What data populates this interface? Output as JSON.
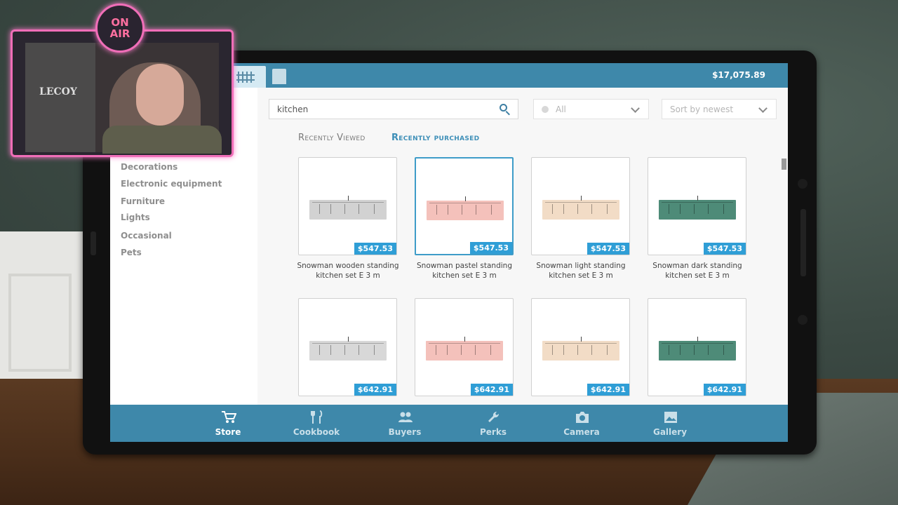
{
  "balance": "$17,075.89",
  "search": {
    "value": "kitchen"
  },
  "filter": {
    "selected": "All"
  },
  "sort": {
    "selected": "Sort by newest"
  },
  "tabs": {
    "recently_viewed": "Recently Viewed",
    "recently_purchased": "Recently purchased"
  },
  "categories": [
    "Decorations",
    "Electronic equipment",
    "Furniture",
    "Lights",
    "Occasional",
    "Pets"
  ],
  "products": [
    {
      "name1": "Snowman wooden standing",
      "name2": "kitchen set E 3 m",
      "price": "$547.53",
      "color": "#d2d2d2"
    },
    {
      "name1": "Snowman pastel standing",
      "name2": "kitchen set E 3 m",
      "price": "$547.53",
      "color": "#f4c1bb"
    },
    {
      "name1": "Snowman light standing",
      "name2": "kitchen set E 3 m",
      "price": "$547.53",
      "color": "#f2dcc6"
    },
    {
      "name1": "Snowman dark standing",
      "name2": "kitchen set E 3 m",
      "price": "$547.53",
      "color": "#4e8b78"
    },
    {
      "price": "$642.91",
      "color": "#d8d8d8"
    },
    {
      "price": "$642.91",
      "color": "#f4c1bb"
    },
    {
      "price": "$642.91",
      "color": "#f2dcc6"
    },
    {
      "price": "$642.91",
      "color": "#4e8b78"
    }
  ],
  "nav": {
    "store": "Store",
    "cookbook": "Cookbook",
    "buyers": "Buyers",
    "perks": "Perks",
    "camera": "Camera",
    "gallery": "Gallery"
  },
  "overlay": {
    "on_air_line1": "ON",
    "on_air_line2": "AIR",
    "sign_text": "LECOY"
  },
  "colors": {
    "accent": "#3e88aa",
    "price_badge": "#2f9ed6",
    "neon": "#f06eb8"
  }
}
